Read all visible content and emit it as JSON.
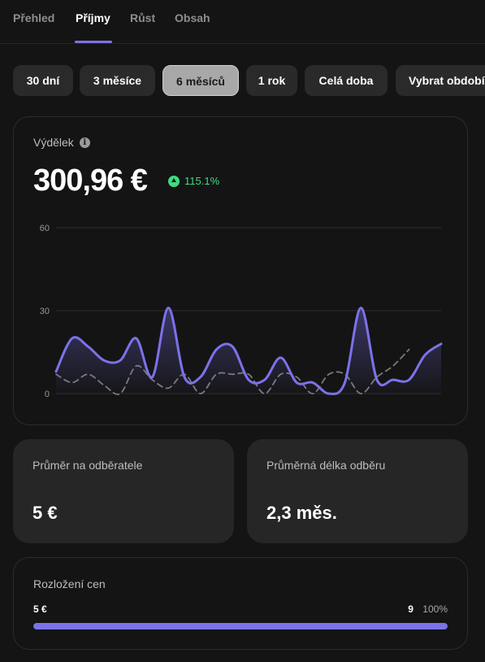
{
  "tabs": [
    {
      "label": "Přehled",
      "active": false
    },
    {
      "label": "Příjmy",
      "active": true
    },
    {
      "label": "Růst",
      "active": false
    },
    {
      "label": "Obsah",
      "active": false
    }
  ],
  "periods": [
    {
      "label": "30 dní",
      "active": false
    },
    {
      "label": "3 měsíce",
      "active": false
    },
    {
      "label": "6 měsíců",
      "active": true
    },
    {
      "label": "1 rok",
      "active": false
    },
    {
      "label": "Celá doba",
      "active": false
    },
    {
      "label": "Vybrat období",
      "active": false
    }
  ],
  "earnings": {
    "label": "Výdělek",
    "value": "300,96 €",
    "change": "115.1%",
    "info_icon": "info-icon",
    "change_icon": "triangle-up-icon"
  },
  "chart_data": {
    "type": "line",
    "y_ticks": [
      "60",
      "30",
      "0"
    ],
    "ylim": [
      0,
      60
    ],
    "series": [
      {
        "color": "#7b72e9",
        "style": "solid",
        "fill": true,
        "values": [
          8,
          20,
          17,
          12,
          12,
          20,
          6,
          31,
          6,
          6,
          16,
          17,
          5,
          5,
          13,
          4,
          4,
          0,
          4,
          31,
          5,
          5,
          5,
          14,
          18
        ]
      },
      {
        "color": "#7a7a7a",
        "style": "dashed",
        "fill": false,
        "values": [
          7,
          4,
          7,
          3,
          0,
          10,
          5,
          2,
          7,
          0,
          7,
          7,
          7,
          0,
          7,
          6,
          0,
          7,
          7,
          0,
          6,
          10,
          16
        ]
      }
    ],
    "grid": true
  },
  "stats": [
    {
      "label": "Průměr na odběratele",
      "value": "5 €"
    },
    {
      "label": "Průměrná délka odběru",
      "value": "2,3 měs."
    }
  ],
  "distribution": {
    "label": "Rozložení cen",
    "price": "5 €",
    "count": "9",
    "percent": "100%",
    "fill_fraction": 1.0,
    "color": "#7b72e9"
  }
}
